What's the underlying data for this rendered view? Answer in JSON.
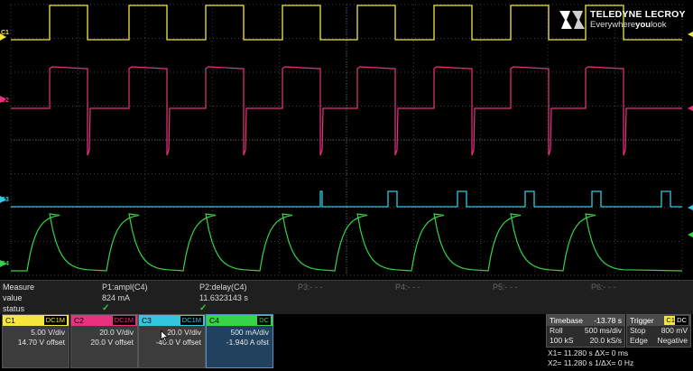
{
  "brand": {
    "name": "TELEDYNE LECROY",
    "tagline": "Everywhereyoulook",
    "tagline_bold": "you"
  },
  "trace_labels": [
    "C1",
    "C2",
    "C3",
    "C4"
  ],
  "trace_colors": {
    "c1": "#f5e63d",
    "c2": "#e8327f",
    "c3": "#33c7df",
    "c4": "#37d447"
  },
  "measure": {
    "row_labels": [
      "Measure",
      "value",
      "status"
    ],
    "params": [
      {
        "name": "P1:ampl(C4)",
        "value": "824 mA",
        "status": "✓",
        "active": true
      },
      {
        "name": "P2:delay(C4)",
        "value": "11.6323143 s",
        "status": "✓",
        "active": true
      },
      {
        "name": "P3:- - -",
        "value": "",
        "status": "",
        "active": false
      },
      {
        "name": "P4:- - -",
        "value": "",
        "status": "",
        "active": false
      },
      {
        "name": "P5:- - -",
        "value": "",
        "status": "",
        "active": false
      },
      {
        "name": "P6:- - -",
        "value": "",
        "status": "",
        "active": false
      }
    ]
  },
  "channels": [
    {
      "label": "C1",
      "coupling": "DC1M",
      "scale": "5.00 V/div",
      "offset": "14.70 V offset",
      "color": "#f5e63d"
    },
    {
      "label": "C2",
      "coupling": "DC1M",
      "scale": "20.0 V/div",
      "offset": "20.0 V offset",
      "color": "#e8327f"
    },
    {
      "label": "C3",
      "coupling": "DC1M",
      "scale": "20.0 V/div",
      "offset": "-40.0 V offset",
      "color": "#33c7df"
    },
    {
      "label": "C4",
      "coupling": "DC",
      "scale": "500 mA/div",
      "offset": "-1.940 A ofst",
      "color": "#37d447",
      "selected": true
    }
  ],
  "timebase": {
    "title": "Timebase",
    "delay": "-13.78 s",
    "mode": "Roll",
    "scale": "500 ms/div",
    "samples": "100 kS",
    "rate": "20.0 kS/s"
  },
  "trigger": {
    "title": "Trigger",
    "source": "C1",
    "coupling": "DC",
    "mode": "Stop",
    "level": "800 mV",
    "type": "Edge",
    "slope": "Negative"
  },
  "cursors": {
    "x1": "X1= 11.280 s ΔX=    0 ms",
    "x2": "X2= 11.280 s 1/ΔX=  0 Hz"
  }
}
